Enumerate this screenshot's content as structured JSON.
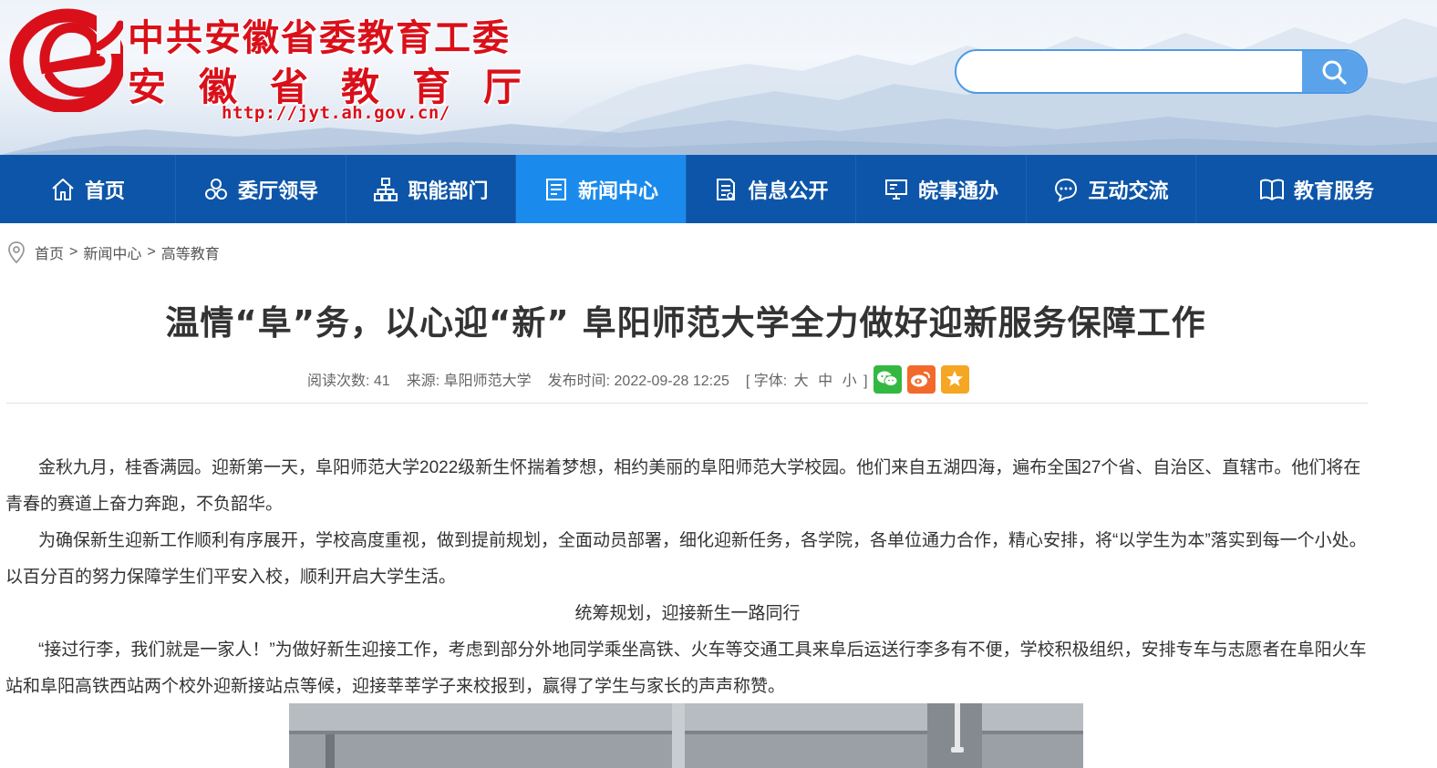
{
  "header": {
    "title_line1": "中共安徽省委教育工委",
    "title_line2": "安徽省教育厅",
    "url": "http://jyt.ah.gov.cn/",
    "search": {
      "value": "",
      "placeholder": ""
    },
    "logo_icon": "e-letter-logo",
    "colors": {
      "brand_red": "#d9101a",
      "search_accent": "#5aa3ea"
    }
  },
  "nav": {
    "colors": {
      "bar": "#0d55a8",
      "active": "#1a8bec"
    },
    "items": [
      {
        "label": "首页",
        "icon": "home-icon"
      },
      {
        "label": "委厅领导",
        "icon": "leaders-icon"
      },
      {
        "label": "职能部门",
        "icon": "org-chart-icon"
      },
      {
        "label": "新闻中心",
        "icon": "news-icon",
        "active": true
      },
      {
        "label": "信息公开",
        "icon": "document-icon"
      },
      {
        "label": "皖事通办",
        "icon": "monitor-icon"
      },
      {
        "label": "互动交流",
        "icon": "chat-icon"
      },
      {
        "label": "教育服务",
        "icon": "book-icon"
      }
    ]
  },
  "breadcrumb": {
    "items": [
      "首页",
      "新闻中心",
      "高等教育"
    ],
    "separator": ">"
  },
  "article": {
    "title": "温情“阜”务，以心迎“新” 阜阳师范大学全力做好迎新服务保障工作",
    "meta": {
      "views_label": "阅读次数:",
      "views": "41",
      "source_label": "来源:",
      "source": "阜阳师范大学",
      "time_label": "发布时间:",
      "time": "2022-09-28 12:25",
      "font_label_open": "[ 字体:",
      "font_large": "大",
      "font_medium": "中",
      "font_small": "小",
      "font_label_close": "]"
    },
    "share": [
      "wechat-icon",
      "weibo-icon",
      "favorite-star-icon"
    ],
    "paragraphs": [
      "金秋九月，桂香满园。迎新第一天，阜阳师范大学2022级新生怀揣着梦想，相约美丽的阜阳师范大学校园。他们来自五湖四海，遍布全国27个省、自治区、直辖市。他们将在青春的赛道上奋力奔跑，不负韶华。",
      "为确保新生迎新工作顺利有序展开，学校高度重视，做到提前规划，全面动员部署，细化迎新任务，各学院，各单位通力合作，精心安排，将“以学生为本”落实到每一个小处。以百分百的努力保障学生们平安入校，顺利开启大学生活。",
      "统筹规划，迎接新生一路同行",
      "“接过行李，我们就是一家人！”为做好新生迎接工作，考虑到部分外地同学乘坐高铁、火车等交通工具来阜后运送行李多有不便，学校积极组织，安排专车与志愿者在阜阳火车站和阜阳高铁西站两个校外迎新接站点等候，迎接莘莘学子来校报到，赢得了学生与家长的声声称赞。"
    ]
  }
}
